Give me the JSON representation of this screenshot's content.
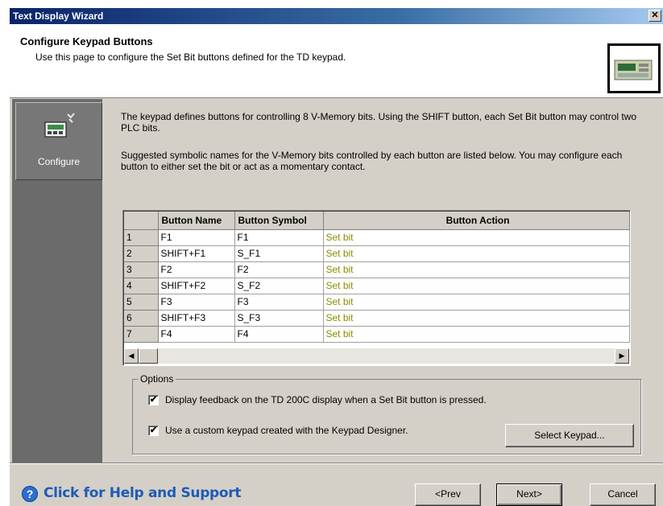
{
  "window": {
    "title": "Text Display Wizard",
    "close_glyph": "✕"
  },
  "header": {
    "title": "Configure Keypad Buttons",
    "subtitle": "Use this page to configure the Set Bit buttons defined for the TD keypad.",
    "device_icon": "td-device-icon"
  },
  "nav": {
    "items": [
      {
        "label": "Configure",
        "icon": "configure-icon"
      }
    ]
  },
  "main": {
    "paragraph1": "The keypad defines buttons for controlling 8 V-Memory bits. Using the SHIFT button, each Set Bit button may control two PLC bits.",
    "paragraph2": "Suggested symbolic names for the V-Memory bits controlled by each button are listed below. You may configure each button to either set the bit or act as a momentary contact."
  },
  "table": {
    "headers": [
      "",
      "Button Name",
      "Button Symbol",
      "Button Action"
    ],
    "rows": [
      {
        "num": "1",
        "name": "F1",
        "symbol": "F1",
        "action": "Set bit"
      },
      {
        "num": "2",
        "name": "SHIFT+F1",
        "symbol": "S_F1",
        "action": "Set bit"
      },
      {
        "num": "3",
        "name": "F2",
        "symbol": "F2",
        "action": "Set bit"
      },
      {
        "num": "4",
        "name": "SHIFT+F2",
        "symbol": "S_F2",
        "action": "Set bit"
      },
      {
        "num": "5",
        "name": "F3",
        "symbol": "F3",
        "action": "Set bit"
      },
      {
        "num": "6",
        "name": "SHIFT+F3",
        "symbol": "S_F3",
        "action": "Set bit"
      },
      {
        "num": "7",
        "name": "F4",
        "symbol": "F4",
        "action": "Set bit"
      }
    ],
    "scroll_left_glyph": "◀",
    "scroll_right_glyph": "▶"
  },
  "options": {
    "legend": "Options",
    "option1": {
      "label": "Display feedback on the TD 200C display when a Set Bit button is pressed.",
      "checked": true
    },
    "option2": {
      "label": "Use a custom keypad created with the Keypad Designer.",
      "checked": true
    },
    "check_glyph": "✔",
    "select_keypad_label": "Select Keypad..."
  },
  "footer": {
    "help_text": "Click for Help and Support",
    "help_glyph": "?",
    "prev_label": "<Prev",
    "next_label": "Next>",
    "cancel_label": "Cancel"
  }
}
